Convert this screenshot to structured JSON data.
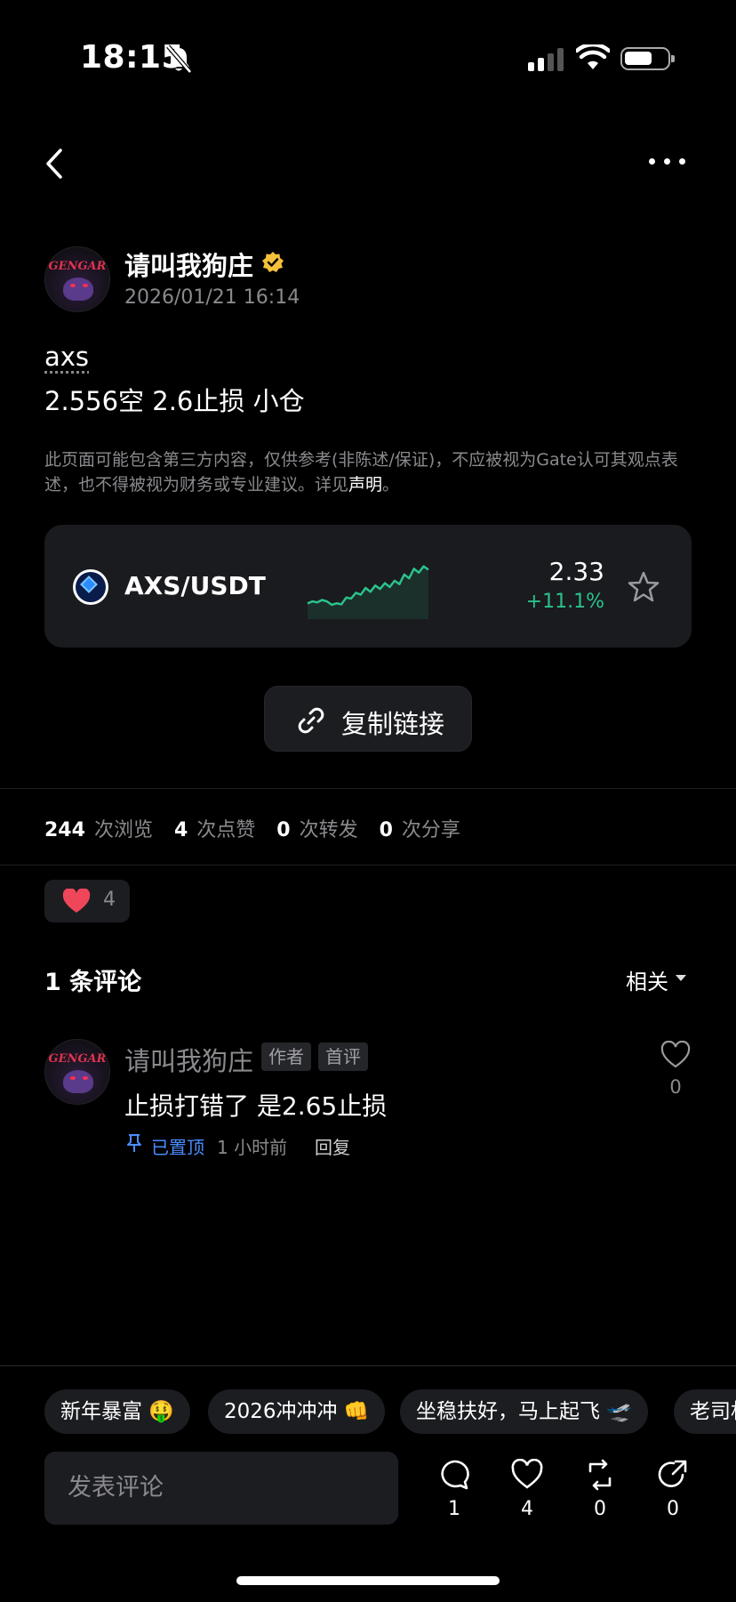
{
  "status_bar": {
    "time": "18:15"
  },
  "author": {
    "name": "请叫我狗庄",
    "timestamp": "2026/01/21 16:14",
    "avatar_text": "GENGAR"
  },
  "post": {
    "line1": "axs",
    "line2": "2.556空 2.6止损 小仓",
    "disclaimer": "此页面可能包含第三方内容，仅供参考(非陈述/保证)，不应被视为Gate认可其观点表述，也不得被视为财务或专业建议。详见",
    "disclaimer_link": "声明",
    "disclaimer_end": "。"
  },
  "market": {
    "pair": "AXS/USDT",
    "price": "2.33",
    "change": "+11.1%",
    "sparkline": [
      0.18,
      0.22,
      0.2,
      0.25,
      0.22,
      0.15,
      0.18,
      0.16,
      0.3,
      0.28,
      0.4,
      0.36,
      0.5,
      0.42,
      0.55,
      0.48,
      0.6,
      0.52,
      0.65,
      0.58,
      0.78,
      0.7,
      0.9,
      0.82,
      0.95,
      0.88
    ],
    "accent": "#2bc28b"
  },
  "copy_link": {
    "label": "复制链接"
  },
  "stats": [
    {
      "num": "244",
      "label": "次浏览"
    },
    {
      "num": "4",
      "label": "次点赞"
    },
    {
      "num": "0",
      "label": "次转发"
    },
    {
      "num": "0",
      "label": "次分享"
    }
  ],
  "reaction": {
    "count": "4"
  },
  "comments": {
    "title": "1 条评论",
    "sort": "相关",
    "items": [
      {
        "name": "请叫我狗庄",
        "tags": [
          "作者",
          "首评"
        ],
        "text": "止损打错了 是2.65止损",
        "pinned": "已置顶",
        "time": "1 小时前",
        "reply": "回复",
        "likes": "0"
      }
    ]
  },
  "quick_chips": [
    "新年暴富 🤑",
    "2026冲冲冲 👊",
    "坐稳扶好，马上起飞 🛫",
    "老司机"
  ],
  "composer": {
    "placeholder": "发表评论",
    "actions": [
      {
        "icon": "comment-icon",
        "count": "1"
      },
      {
        "icon": "heart-icon",
        "count": "4"
      },
      {
        "icon": "repost-icon",
        "count": "0"
      },
      {
        "icon": "share-icon",
        "count": "0"
      }
    ]
  }
}
